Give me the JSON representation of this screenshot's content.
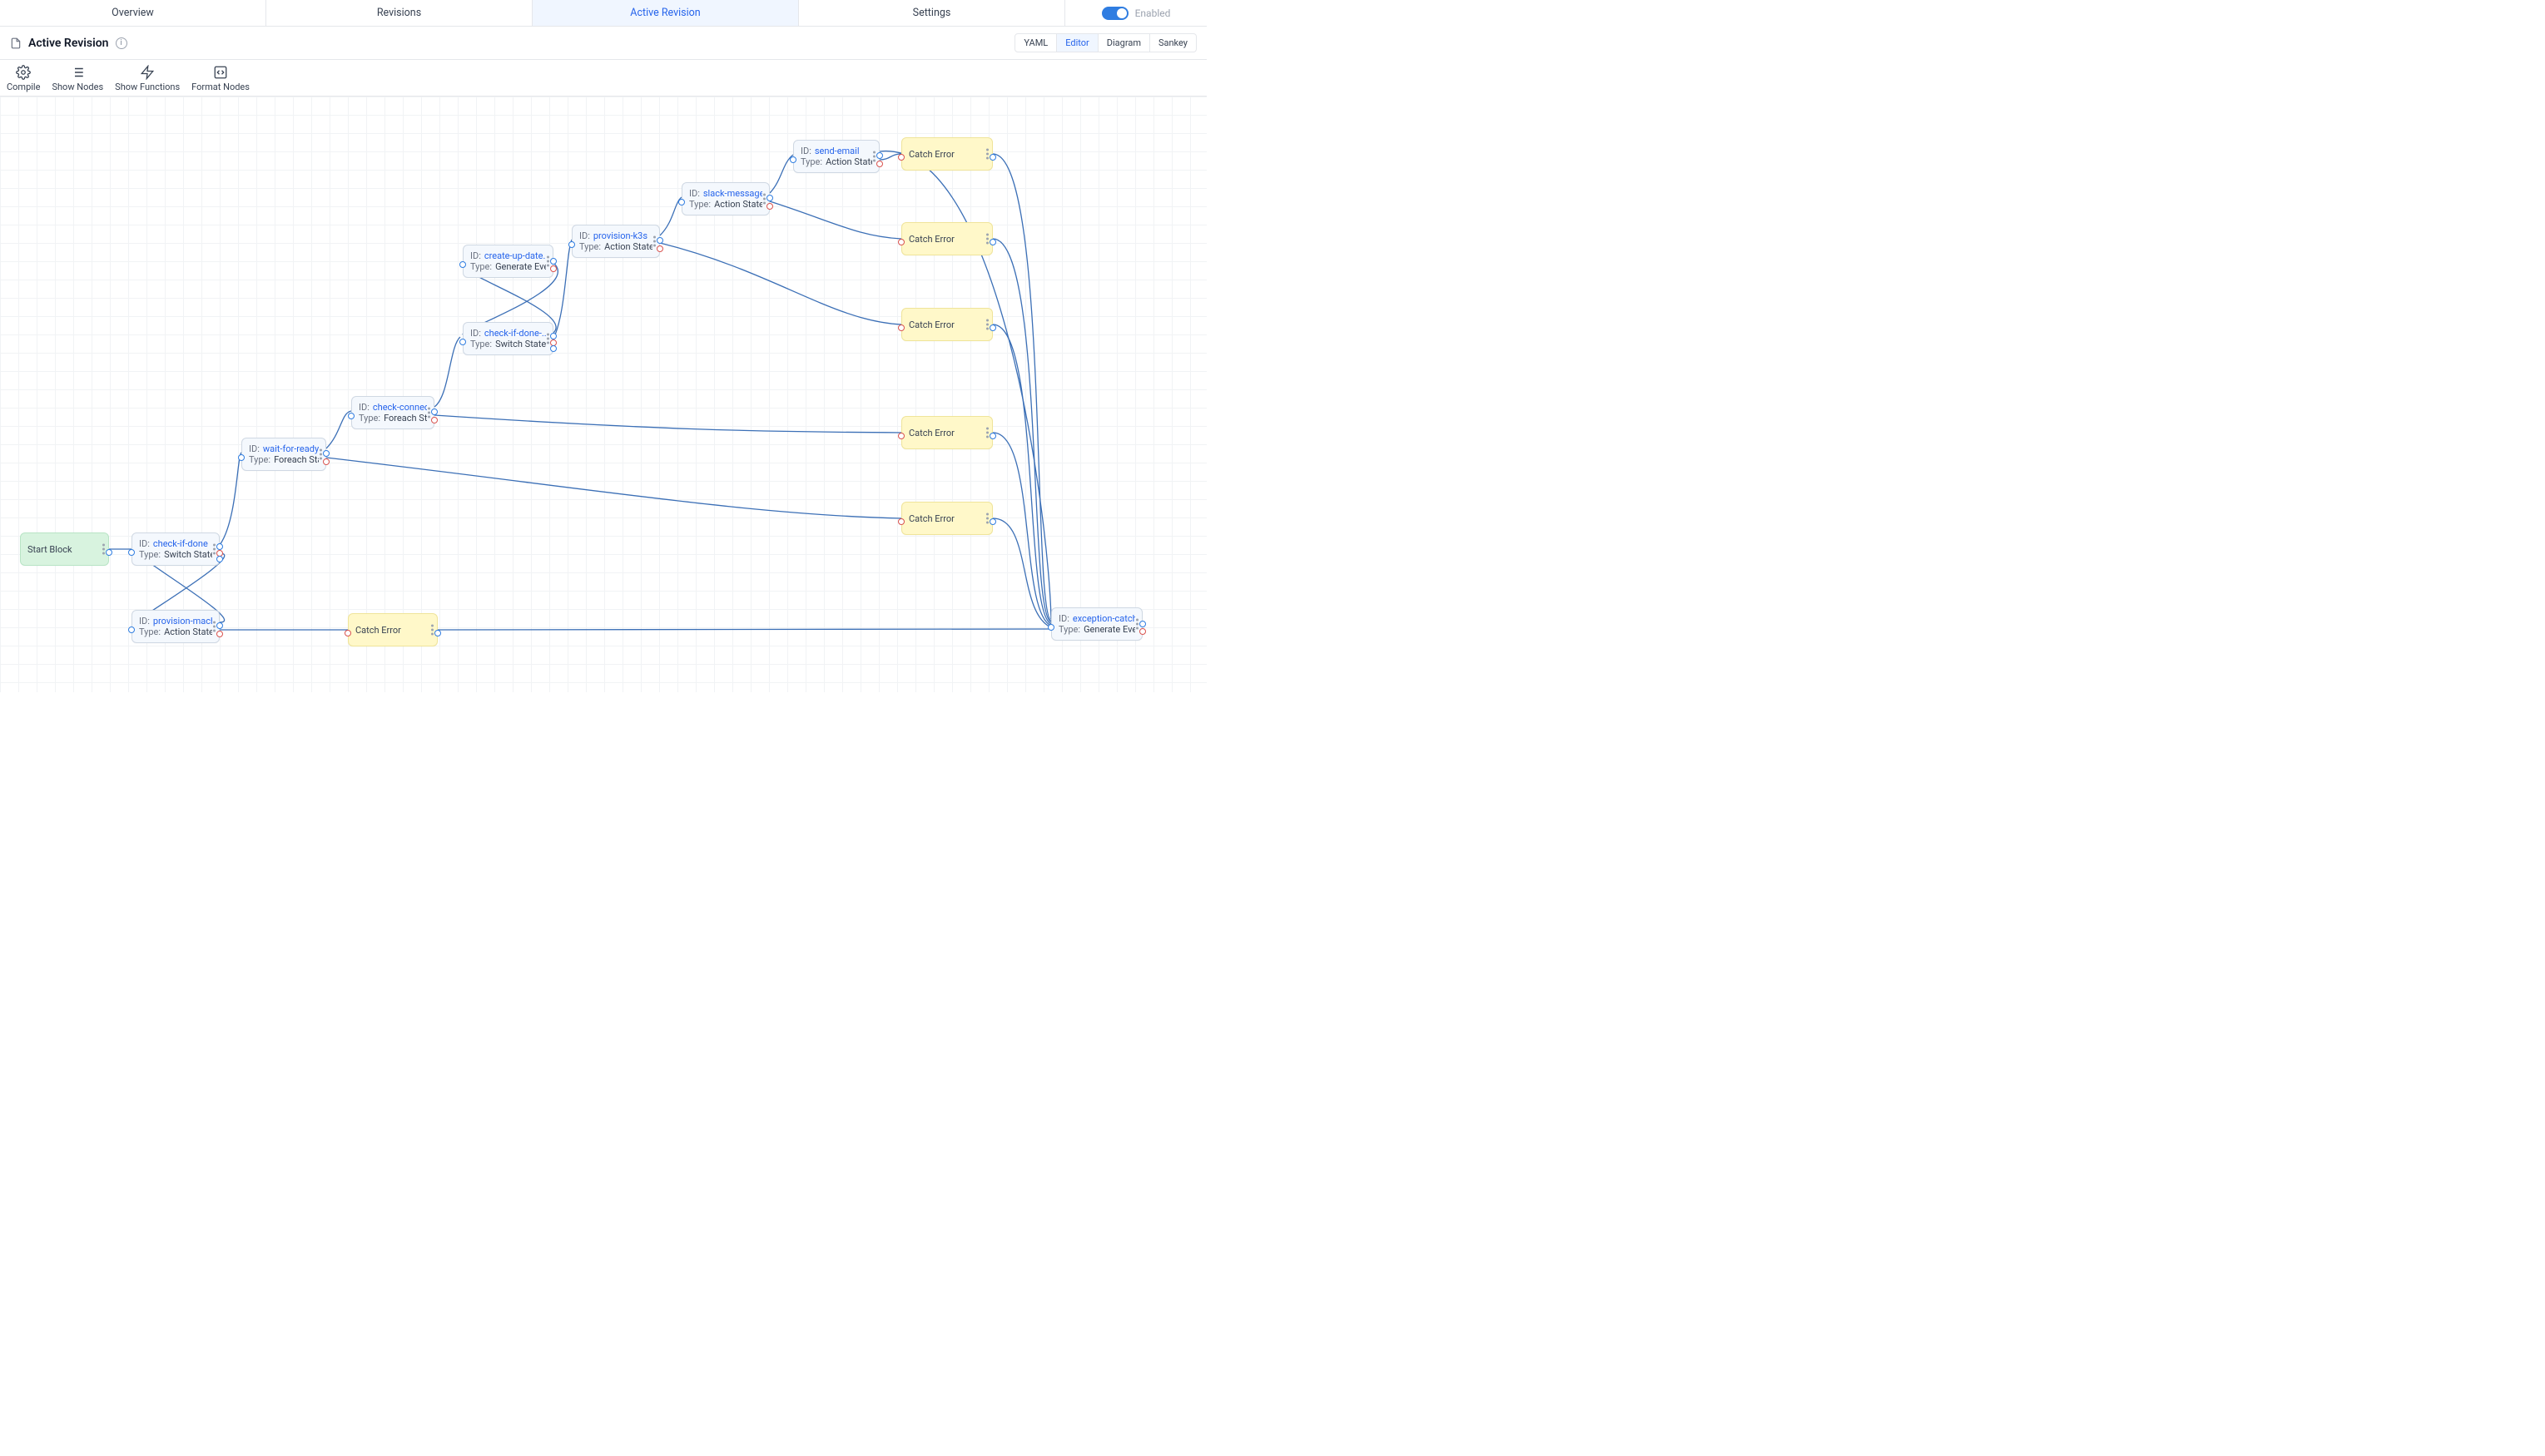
{
  "tabs": {
    "overview": "Overview",
    "revisions": "Revisions",
    "active_revision": "Active Revision",
    "settings": "Settings",
    "enabled_label": "Enabled"
  },
  "header": {
    "title": "Active Revision"
  },
  "view_buttons": {
    "yaml": "YAML",
    "editor": "Editor",
    "diagram": "Diagram",
    "sankey": "Sankey"
  },
  "toolbar": {
    "compile": "Compile",
    "show_nodes": "Show Nodes",
    "show_functions": "Show Functions",
    "format_nodes": "Format Nodes"
  },
  "labels": {
    "id": "ID:",
    "type": "Type:"
  },
  "nodes": {
    "start": {
      "label": "Start Block"
    },
    "check_if_done": {
      "id": "check-if-done",
      "type": "Switch State"
    },
    "provision_machi": {
      "id": "provision-machi...",
      "type": "Action State"
    },
    "wait_for_ready": {
      "id": "wait-for-ready",
      "type": "Foreach State"
    },
    "check_connecti": {
      "id": "check-connecti...",
      "type": "Foreach State"
    },
    "create_up_date": {
      "id": "create-up-date...",
      "type": "Generate Event State"
    },
    "check_if_done2": {
      "id": "check-if-done-...",
      "type": "Switch State"
    },
    "provision_k3s": {
      "id": "provision-k3s",
      "type": "Action State"
    },
    "slack_message": {
      "id": "slack-message-...",
      "type": "Action State"
    },
    "send_email": {
      "id": "send-email",
      "type": "Action State"
    },
    "exception_catch": {
      "id": "exception-catch",
      "type": "Generate Event State"
    },
    "catch_error": "Catch Error"
  }
}
